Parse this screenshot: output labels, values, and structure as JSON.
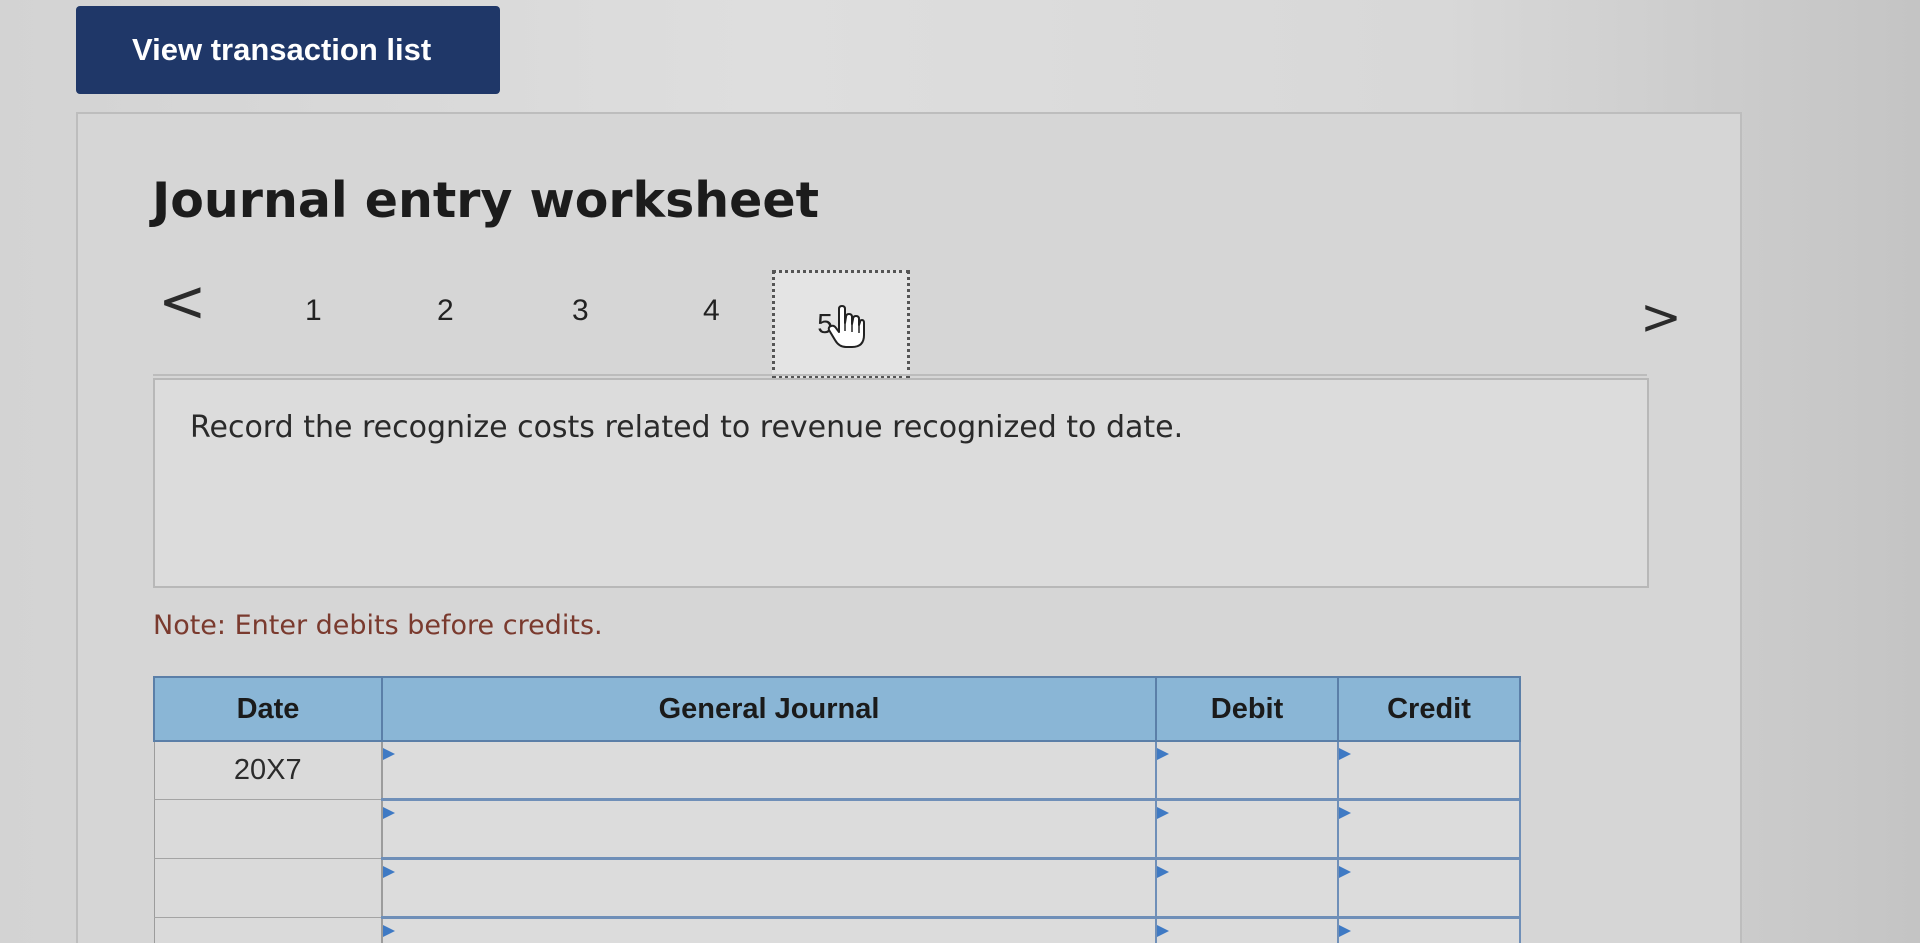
{
  "toolbar": {
    "view_transactions_label": "View transaction list"
  },
  "worksheet": {
    "title": "Journal entry worksheet",
    "steps": [
      "1",
      "2",
      "3",
      "4",
      "5"
    ],
    "current_step": "5",
    "prev_arrow": "<",
    "next_arrow": ">",
    "instruction": "Record the recognize costs related to revenue recognized to date.",
    "note": "Note: Enter debits before credits."
  },
  "journal_table": {
    "headers": {
      "date": "Date",
      "general_journal": "General Journal",
      "debit": "Debit",
      "credit": "Credit"
    },
    "rows": [
      {
        "date": "20X7",
        "account": "",
        "debit": "",
        "credit": ""
      },
      {
        "date": "",
        "account": "",
        "debit": "",
        "credit": ""
      },
      {
        "date": "",
        "account": "",
        "debit": "",
        "credit": ""
      },
      {
        "date": "",
        "account": "",
        "debit": "",
        "credit": ""
      }
    ]
  },
  "colors": {
    "button_bg": "#1f3768",
    "header_bg": "#8ab6d6",
    "input_border": "#6f8fb8",
    "note_text": "#7a3a2e"
  },
  "icons": {
    "cursor": "hand-pointer-icon"
  }
}
